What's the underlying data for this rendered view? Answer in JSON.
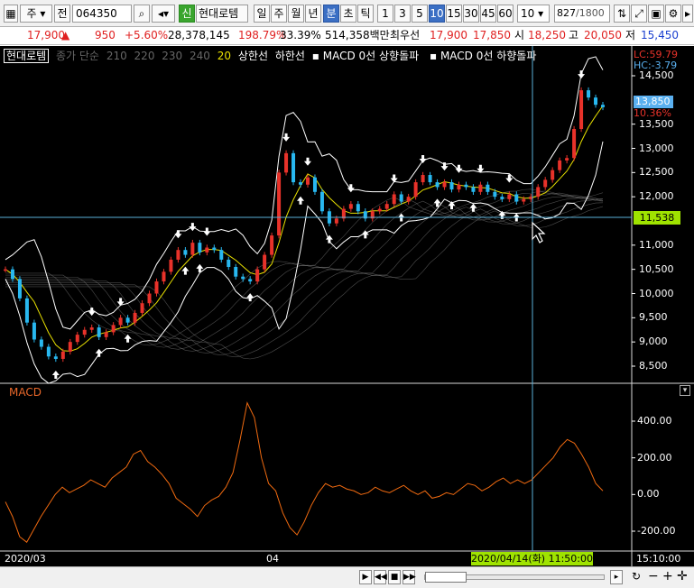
{
  "toolbar": {
    "mode": "주",
    "prev_label": "전",
    "code": "064350",
    "badge": "신",
    "stock_name": "현대로템",
    "periods": [
      "일",
      "주",
      "월",
      "년",
      "분",
      "초",
      "틱"
    ],
    "intervals": [
      "1",
      "3",
      "5",
      "10",
      "15",
      "30",
      "45",
      "60"
    ],
    "interval_value": "10",
    "count_value": "827",
    "count_total": "/1800"
  },
  "quote": {
    "price": "17,900",
    "arrow": "▲",
    "change": "950",
    "change_pct": "+5.60%",
    "volume": "28,378,145",
    "volume_ratio": "198.79%",
    "turnover": "33.39%",
    "amount": "514,358백만",
    "label_best": "최우선",
    "best_ask": "17,900",
    "best_bid": "17,850",
    "open_label": "시",
    "open": "18,250",
    "high_label": "고",
    "high": "20,050",
    "low_label": "저",
    "low": "15,450"
  },
  "legend": {
    "name": "현대로템",
    "ma_label": "종가 단순",
    "ma_values": [
      "210",
      "220",
      "230",
      "240"
    ],
    "ma_last": "20",
    "upper": "상한선",
    "lower": "하한선",
    "macd_up": "MACD 0선 상향돌파",
    "macd_down": "MACD 0선 하향돌파"
  },
  "price_axis": {
    "lc": "LC:59.79",
    "hc": "HC:-3.79",
    "ticks": [
      "14,500",
      "13,500",
      "13,000",
      "12,500",
      "12,000",
      "11,000",
      "10,500",
      "10,000",
      "9,500",
      "9,000",
      "8,500"
    ],
    "last_price": "13,850",
    "last_pct": "10.36%",
    "crosshair_price": "11,538"
  },
  "macd": {
    "label": "MACD",
    "ticks": [
      "400.00",
      "200.00",
      "0.00",
      "-200.00"
    ]
  },
  "time_axis": {
    "start": "2020/03",
    "mid": "04",
    "cursor": "2020/04/14(화) 11:50:00",
    "clock": "15:10:00"
  },
  "colors": {
    "chart_bg": "#000000",
    "candle_up": "#e8322a",
    "candle_down": "#28b8f0",
    "ma20": "#e8e000",
    "band": "#ffffff",
    "macd_line": "#f06a10",
    "crosshair": "#5ab0d8",
    "cursor_box": "#9fe300"
  },
  "chart_data": {
    "type": "line",
    "price_series": [
      10500,
      10300,
      9900,
      9400,
      9050,
      8900,
      8700,
      8650,
      8800,
      9000,
      9150,
      9250,
      9300,
      9100,
      9200,
      9350,
      9500,
      9400,
      9600,
      9800,
      10000,
      10250,
      10450,
      10700,
      10900,
      10800,
      11050,
      10850,
      10950,
      10900,
      10700,
      10550,
      10350,
      10300,
      10250,
      10500,
      10800,
      11200,
      12500,
      12900,
      12300,
      12250,
      12400,
      12100,
      11700,
      11450,
      11550,
      11750,
      11850,
      11700,
      11550,
      11700,
      11750,
      11850,
      12050,
      11900,
      12000,
      12300,
      12450,
      12300,
      12200,
      12300,
      12150,
      12250,
      12200,
      12100,
      12250,
      12100,
      12000,
      11950,
      12050,
      11900,
      11950,
      12000,
      12200,
      12350,
      12550,
      12750,
      12800,
      13400,
      14200,
      14050,
      13900,
      13850
    ],
    "macd_series": [
      -40,
      -120,
      -230,
      -260,
      -190,
      -120,
      -60,
      0,
      40,
      10,
      30,
      50,
      80,
      60,
      40,
      90,
      120,
      150,
      220,
      240,
      180,
      150,
      110,
      60,
      -20,
      -50,
      -80,
      -120,
      -60,
      -30,
      -10,
      40,
      120,
      300,
      500,
      420,
      200,
      60,
      20,
      -100,
      -180,
      -220,
      -150,
      -60,
      10,
      60,
      40,
      50,
      30,
      20,
      0,
      10,
      40,
      20,
      10,
      30,
      50,
      20,
      0,
      20,
      -20,
      -10,
      10,
      0,
      30,
      60,
      50,
      20,
      40,
      70,
      90,
      60,
      80,
      60,
      80,
      120,
      160,
      200,
      260,
      300,
      280,
      220,
      150,
      60,
      20
    ],
    "macd_ylim": [
      -200,
      400
    ],
    "price_ylim": [
      8500,
      14500
    ]
  }
}
